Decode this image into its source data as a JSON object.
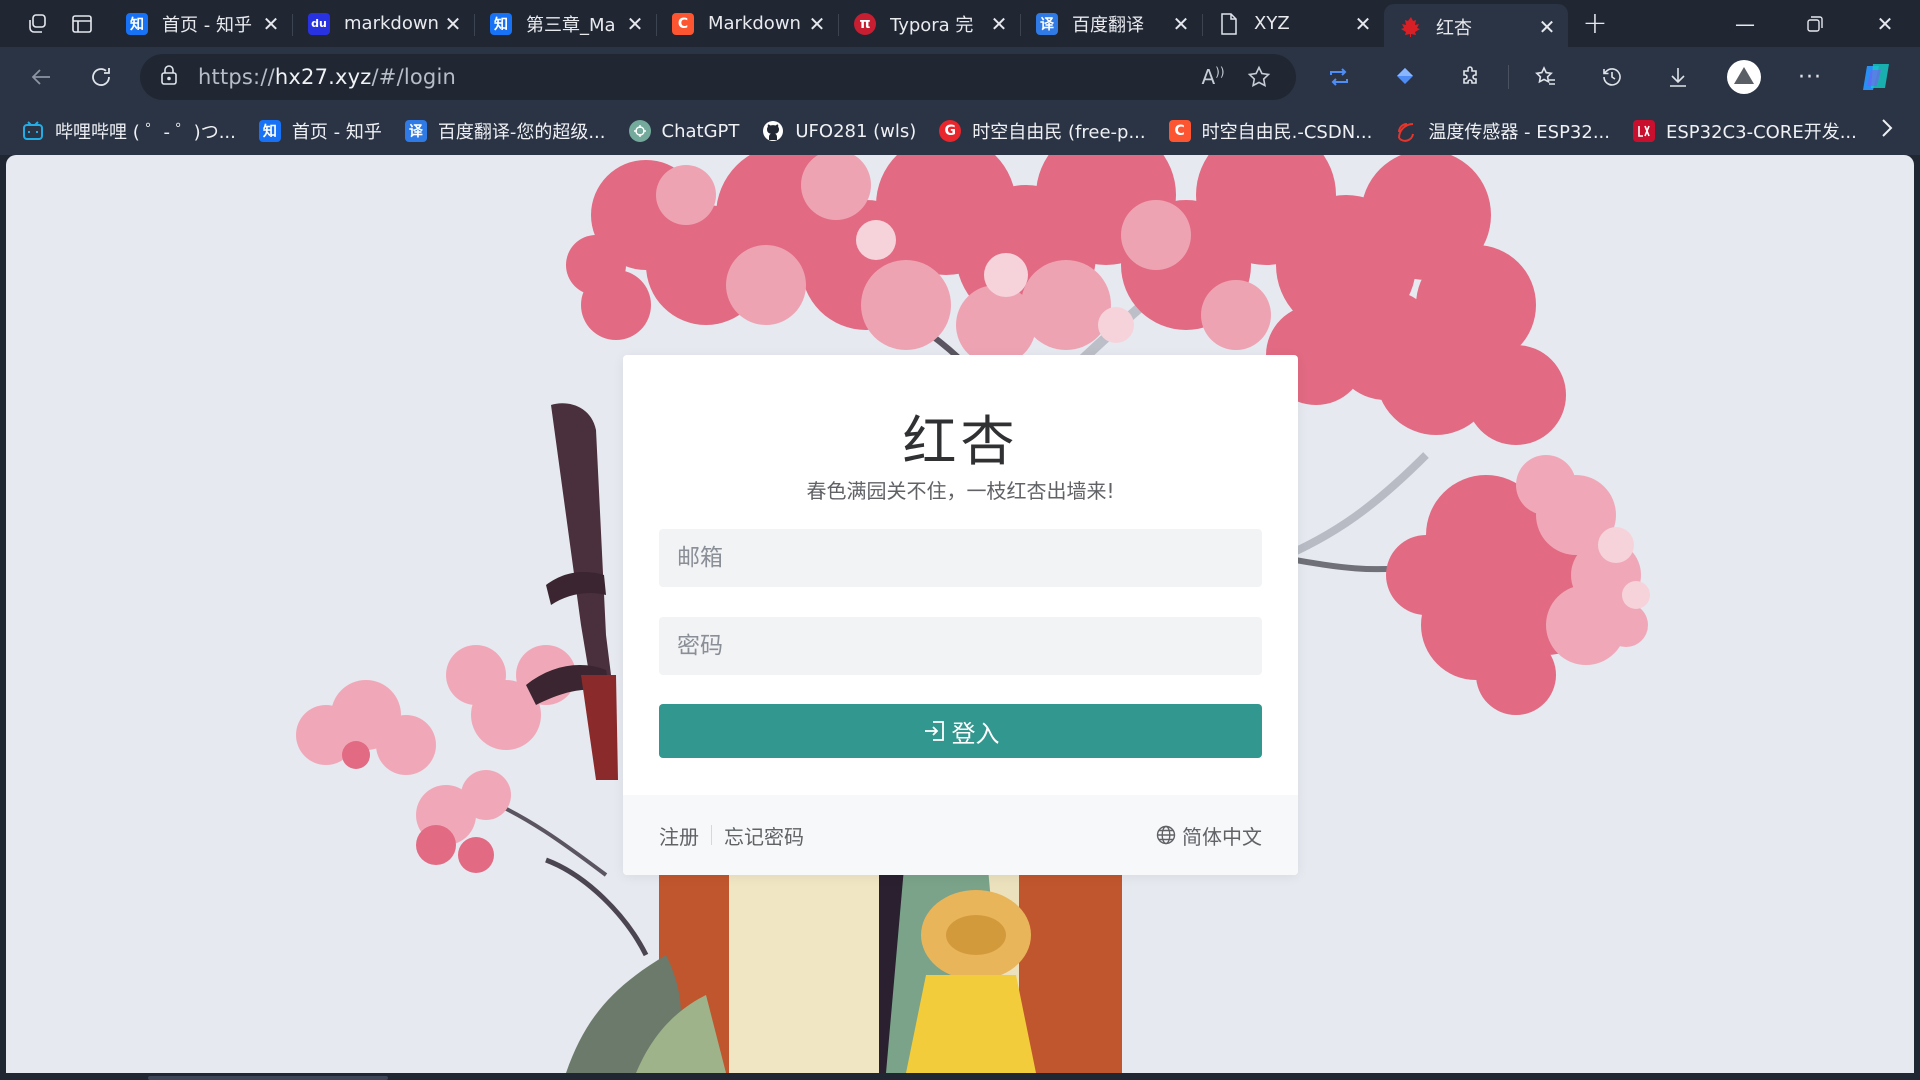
{
  "browser": {
    "tabs": [
      {
        "title": "首页 - 知乎",
        "favicon": "知",
        "favicon_color": "#1772f6"
      },
      {
        "title": "markdown",
        "favicon": "du",
        "favicon_color": "#2932e1"
      },
      {
        "title": "第三章_Ma",
        "favicon": "知",
        "favicon_color": "#1772f6"
      },
      {
        "title": "Markdown",
        "favicon": "C",
        "favicon_color": "#fc5531"
      },
      {
        "title": "Typora 完",
        "favicon": "π",
        "favicon_color": "#c81e32"
      },
      {
        "title": "百度翻译",
        "favicon": "译",
        "favicon_color": "#2f7ae5"
      },
      {
        "title": "XYZ",
        "favicon": "page-icon",
        "favicon_color": "#dfe3ea"
      },
      {
        "title": "红杏",
        "favicon": "maple-leaf-icon",
        "favicon_color": "#d91f26",
        "active": true
      }
    ],
    "address": {
      "prefix": "https://",
      "host": "hx27.xyz",
      "path": "/#/login"
    },
    "bookmarks": [
      {
        "label": "哔哩哔哩 ( ゜- ゜)つ...",
        "favicon": "tv",
        "color": "#23ade5"
      },
      {
        "label": "首页 - 知乎",
        "favicon": "知",
        "color": "#1772f6"
      },
      {
        "label": "百度翻译-您的超级...",
        "favicon": "译",
        "color": "#2f7ae5"
      },
      {
        "label": "ChatGPT",
        "favicon": "gpt",
        "color": "#74aa9c"
      },
      {
        "label": "UFO281 (wls)",
        "favicon": "github",
        "color": "#ffffff"
      },
      {
        "label": "时空自由民 (free-p...",
        "favicon": "G",
        "color": "#e8262c"
      },
      {
        "label": "时空自由民.-CSDN...",
        "favicon": "C",
        "color": "#fc5531"
      },
      {
        "label": "温度传感器 - ESP32...",
        "favicon": "esp",
        "color": "#e7352c"
      },
      {
        "label": "ESP32C3-CORE开发...",
        "favicon": "lx",
        "color": "#c8102e"
      }
    ]
  },
  "page": {
    "title": "红杏",
    "subtitle": "春色满园关不住，一枝红杏出墙来!",
    "email_placeholder": "邮箱",
    "password_placeholder": "密码",
    "login_label": "登入",
    "register_link": "注册",
    "forgot_link": "忘记密码",
    "language": "简体中文",
    "accent_color": "#31978f"
  }
}
